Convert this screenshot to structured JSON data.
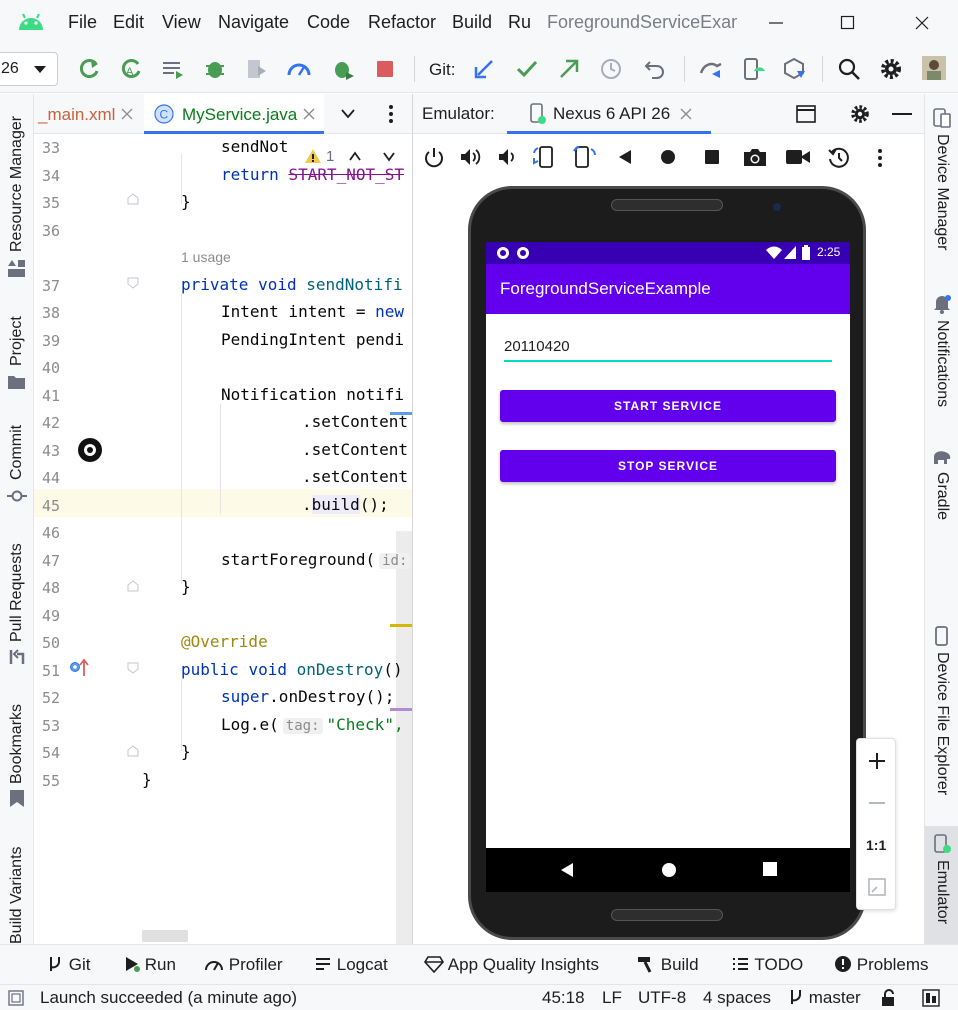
{
  "menu": {
    "file": "File",
    "edit": "Edit",
    "view": "View",
    "navigate": "Navigate",
    "code": "Code",
    "refactor": "Refactor",
    "build": "Build",
    "run": "Ru",
    "window_title": "ForegroundServiceExamp"
  },
  "toolbar": {
    "config_value": "26",
    "git_label": "Git:"
  },
  "left_tools": [
    "Resource Manager",
    "Project",
    "Commit",
    "Pull Requests",
    "Bookmarks",
    "Build Variants"
  ],
  "right_tools": [
    "Device Manager",
    "Notifications",
    "Gradle",
    "Device File Explorer",
    "Emulator"
  ],
  "editor": {
    "tabs": [
      "_main.xml",
      "MyService.java"
    ],
    "inspection_count": "1",
    "usage_hint": "1 usage",
    "lines": [
      {
        "n": "33",
        "code": "sendNot"
      },
      {
        "n": "34",
        "code": "return START_NOT_ST"
      },
      {
        "n": "35",
        "code": "}"
      },
      {
        "n": "36",
        "code": ""
      },
      {
        "n": "37",
        "code": "private void sendNotifi"
      },
      {
        "n": "38",
        "code": "Intent intent = new"
      },
      {
        "n": "39",
        "code": "PendingIntent pendi"
      },
      {
        "n": "40",
        "code": ""
      },
      {
        "n": "41",
        "code": "Notification notifi"
      },
      {
        "n": "42",
        "code": ".setContent"
      },
      {
        "n": "43",
        "code": ".setContent"
      },
      {
        "n": "44",
        "code": ".setContent"
      },
      {
        "n": "45",
        "code": ".build();"
      },
      {
        "n": "46",
        "code": ""
      },
      {
        "n": "47",
        "code": "startForeground("
      },
      {
        "n": "48",
        "code": "}"
      },
      {
        "n": "49",
        "code": ""
      },
      {
        "n": "50",
        "code": "@Override"
      },
      {
        "n": "51",
        "code": "public void onDestroy()"
      },
      {
        "n": "52",
        "code": "super.onDestroy();"
      },
      {
        "n": "53",
        "code": "Log.e("
      },
      {
        "n": "54",
        "code": "}"
      },
      {
        "n": "55",
        "code": "}"
      }
    ],
    "hint_id": "id:",
    "hint_tag": "tag:",
    "check_string": "\"Check\","
  },
  "emulator": {
    "label": "Emulator:",
    "device_tab": "Nexus 6 API 26",
    "zoom_reset": "1:1"
  },
  "app": {
    "time": "2:25",
    "title": "ForegroundServiceExample",
    "input_value": "20110420",
    "start_button": "START SERVICE",
    "stop_button": "STOP SERVICE"
  },
  "bottom_tools": [
    "Git",
    "Run",
    "Profiler",
    "Logcat",
    "App Quality Insights",
    "Build",
    "TODO",
    "Problems"
  ],
  "status": {
    "message": "Launch succeeded (a minute ago)",
    "position": "45:18",
    "line_sep": "LF",
    "encoding": "UTF-8",
    "indent": "4 spaces",
    "branch": "master"
  },
  "colors": {
    "primary": "#6200ee",
    "primary_dark": "#3700b3",
    "accent": "#03dac5",
    "ide_blue": "#3574f0"
  }
}
